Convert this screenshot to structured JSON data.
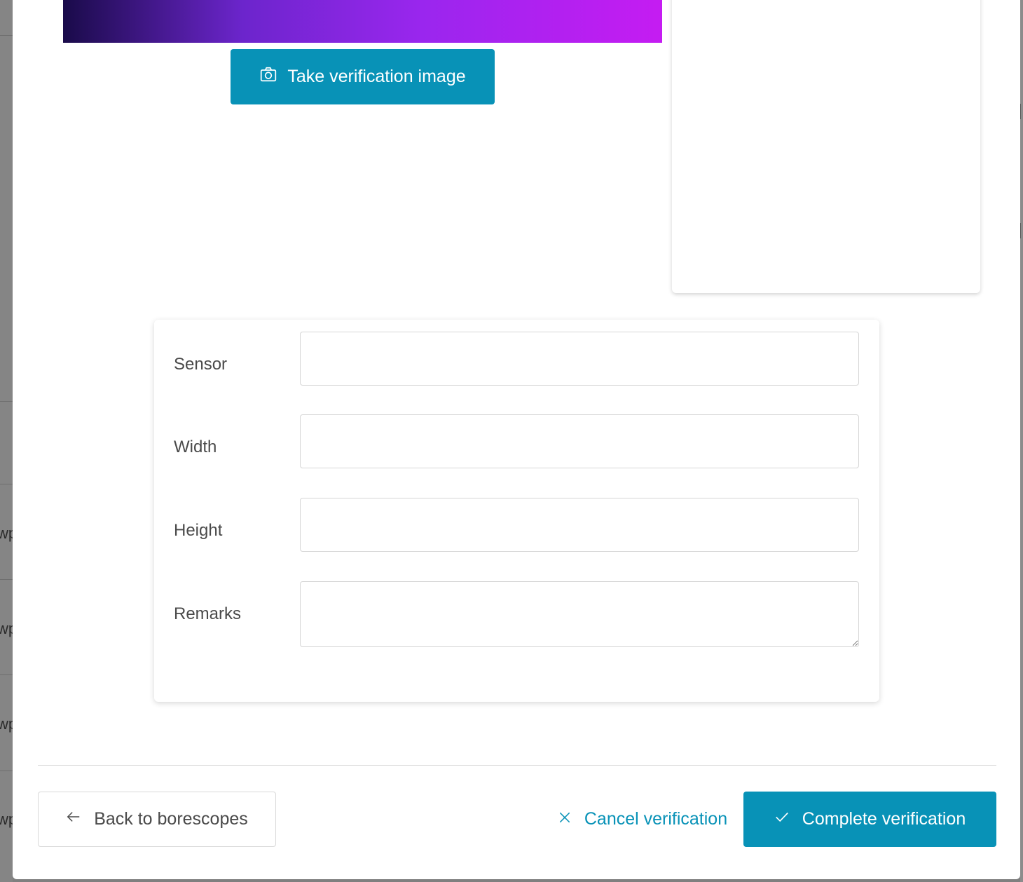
{
  "background": {
    "row_snippets": [
      "wp",
      "wp",
      "wp",
      "wp"
    ]
  },
  "capture": {
    "button_label": "Take verification image",
    "icon": "camera-icon"
  },
  "form": {
    "fields": [
      {
        "label": "Sensor",
        "value": ""
      },
      {
        "label": "Width",
        "value": ""
      },
      {
        "label": "Height",
        "value": ""
      },
      {
        "label": "Remarks",
        "value": ""
      }
    ]
  },
  "footer": {
    "back_label": "Back to borescopes",
    "back_icon": "arrow-left-icon",
    "cancel_label": "Cancel verification",
    "cancel_icon": "close-icon",
    "complete_label": "Complete verification",
    "complete_icon": "checkmark-icon"
  },
  "colors": {
    "accent": "#0892b7",
    "text": "#4a4a4a",
    "border": "#d6d6d6"
  }
}
